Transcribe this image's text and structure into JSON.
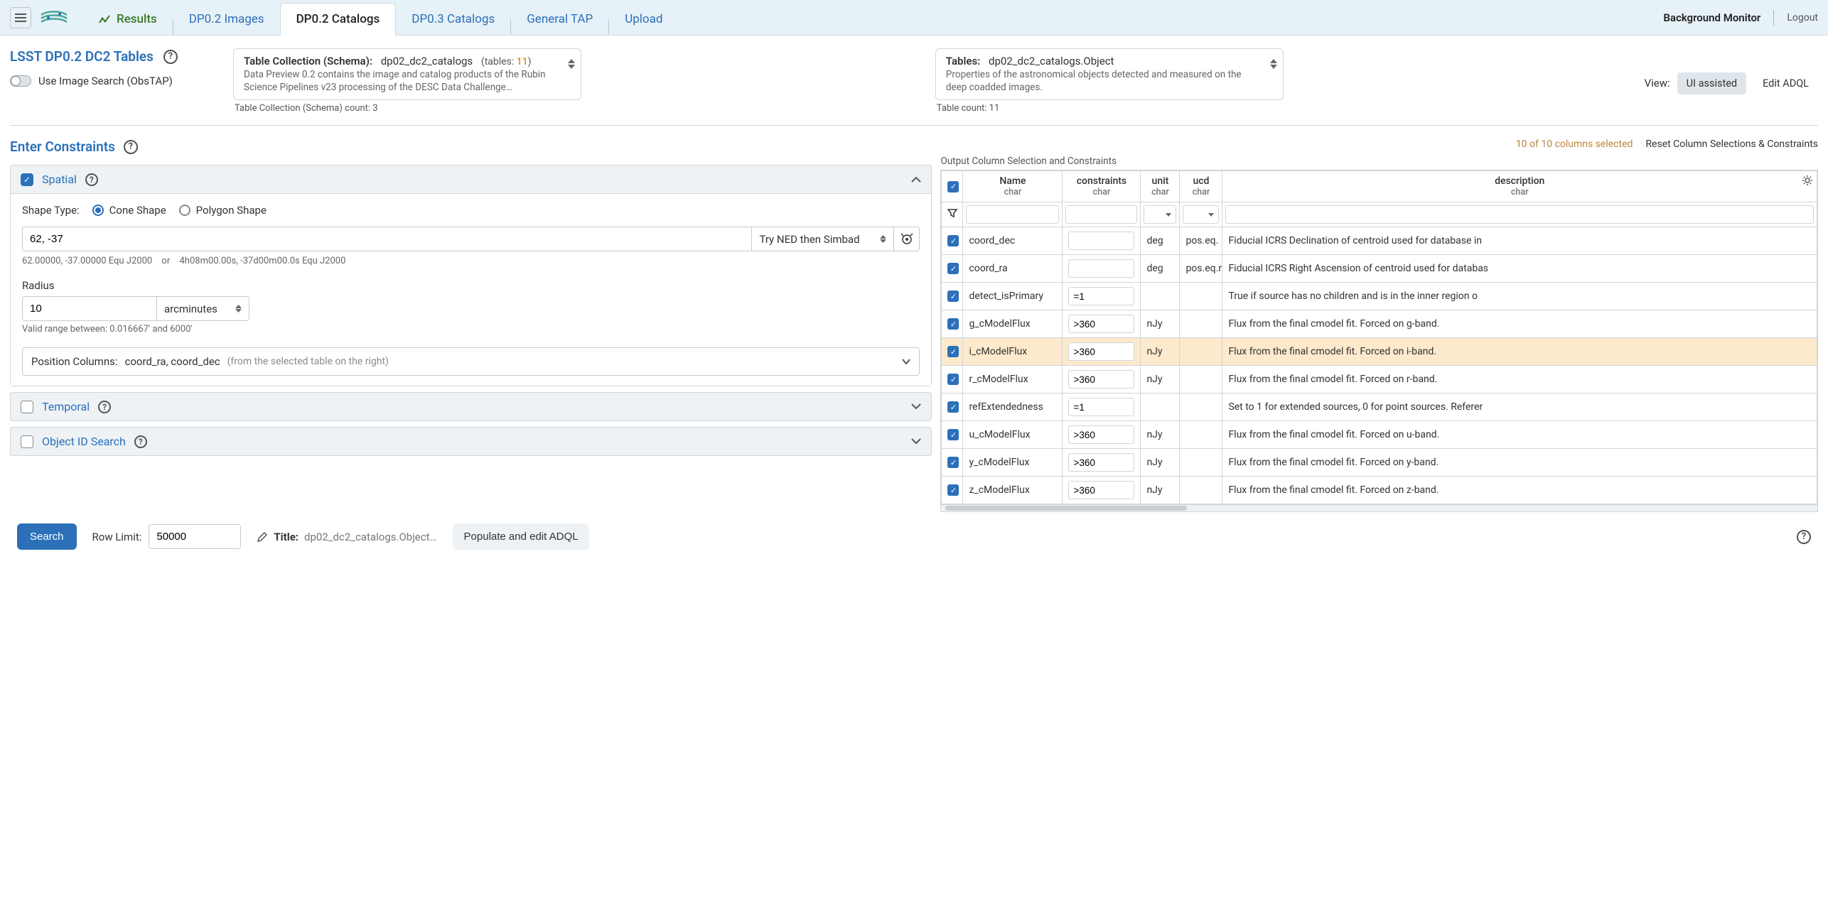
{
  "header": {
    "tabs": {
      "results": "Results",
      "dp02_images": "DP0.2 Images",
      "dp02_catalogs": "DP0.2 Catalogs",
      "dp03_catalogs": "DP0.3 Catalogs",
      "general_tap": "General TAP",
      "upload": "Upload"
    },
    "bg_monitor": "Background Monitor",
    "logout": "Logout"
  },
  "catalog": {
    "title": "LSST DP0.2 DC2 Tables",
    "obstap_label": "Use Image Search (ObsTAP)"
  },
  "schema": {
    "label": "Table Collection (Schema):",
    "value": "dp02_dc2_catalogs",
    "tables_label": "(tables:",
    "tables_count": "11",
    "tables_close": ")",
    "desc": "Data Preview 0.2 contains the image and catalog products of the Rubin Science Pipelines v23 processing of the DESC Data Challenge…",
    "below": "Table Collection (Schema) count: 3"
  },
  "table": {
    "label": "Tables:",
    "value": "dp02_dc2_catalogs.Object",
    "desc": "Properties of the astronomical objects detected and measured on the deep coadded images.",
    "below": "Table count: 11"
  },
  "view": {
    "label": "View:",
    "ui_assisted": "UI assisted",
    "edit_adql": "Edit ADQL"
  },
  "constraints": {
    "title": "Enter Constraints",
    "spatial": {
      "title": "Spatial",
      "shape_label": "Shape Type:",
      "cone": "Cone Shape",
      "polygon": "Polygon Shape",
      "coords_value": "62, -37",
      "resolver": "Try NED then Simbad",
      "note_a": "62.00000, -37.00000  Equ J2000",
      "note_or": "or",
      "note_b": "4h08m00.00s, -37d00m00.0s  Equ J2000",
      "radius_label": "Radius",
      "radius_value": "10",
      "radius_unit": "arcminutes",
      "radius_range": "Valid range between: 0.016667' and 6000'",
      "poscols_label": "Position Columns:",
      "poscols_value": "coord_ra, coord_dec",
      "poscols_hint": "(from the selected table on the right)"
    },
    "temporal": "Temporal",
    "objectid": "Object ID Search"
  },
  "columns": {
    "selected_count": "10 of 10 columns selected",
    "reset": "Reset Column Selections & Constraints",
    "label": "Output Column Selection and Constraints",
    "headers": {
      "name": "Name",
      "constraints": "constraints",
      "unit": "unit",
      "ucd": "ucd",
      "description": "description",
      "char": "char"
    },
    "rows": [
      {
        "name": "coord_dec",
        "con": "",
        "unit": "deg",
        "ucd": "pos.eq.",
        "desc": "Fiducial ICRS Declination of centroid used for database in"
      },
      {
        "name": "coord_ra",
        "con": "",
        "unit": "deg",
        "ucd": "pos.eq.r",
        "desc": "Fiducial ICRS Right Ascension of centroid used for databas"
      },
      {
        "name": "detect_isPrimary",
        "con": "=1",
        "unit": "",
        "ucd": "",
        "desc": "True if source has no children and is in the inner region o"
      },
      {
        "name": "g_cModelFlux",
        "con": ">360",
        "unit": "nJy",
        "ucd": "",
        "desc": "Flux from the final cmodel fit. Forced on g-band."
      },
      {
        "name": "i_cModelFlux",
        "con": ">360",
        "unit": "nJy",
        "ucd": "",
        "desc": "Flux from the final cmodel fit. Forced on i-band.",
        "sel": true
      },
      {
        "name": "r_cModelFlux",
        "con": ">360",
        "unit": "nJy",
        "ucd": "",
        "desc": "Flux from the final cmodel fit. Forced on r-band."
      },
      {
        "name": "refExtendedness",
        "con": "=1",
        "unit": "",
        "ucd": "",
        "desc": "Set to 1 for extended sources, 0 for point sources. Referer"
      },
      {
        "name": "u_cModelFlux",
        "con": ">360",
        "unit": "nJy",
        "ucd": "",
        "desc": "Flux from the final cmodel fit. Forced on u-band."
      },
      {
        "name": "y_cModelFlux",
        "con": ">360",
        "unit": "nJy",
        "ucd": "",
        "desc": "Flux from the final cmodel fit. Forced on y-band."
      },
      {
        "name": "z_cModelFlux",
        "con": ">360",
        "unit": "nJy",
        "ucd": "",
        "desc": "Flux from the final cmodel fit. Forced on z-band."
      }
    ]
  },
  "footer": {
    "search": "Search",
    "rowlimit_label": "Row Limit:",
    "rowlimit_value": "50000",
    "title_label": "Title:",
    "title_value": "dp02_dc2_catalogs.Object…",
    "populate": "Populate and edit ADQL"
  }
}
